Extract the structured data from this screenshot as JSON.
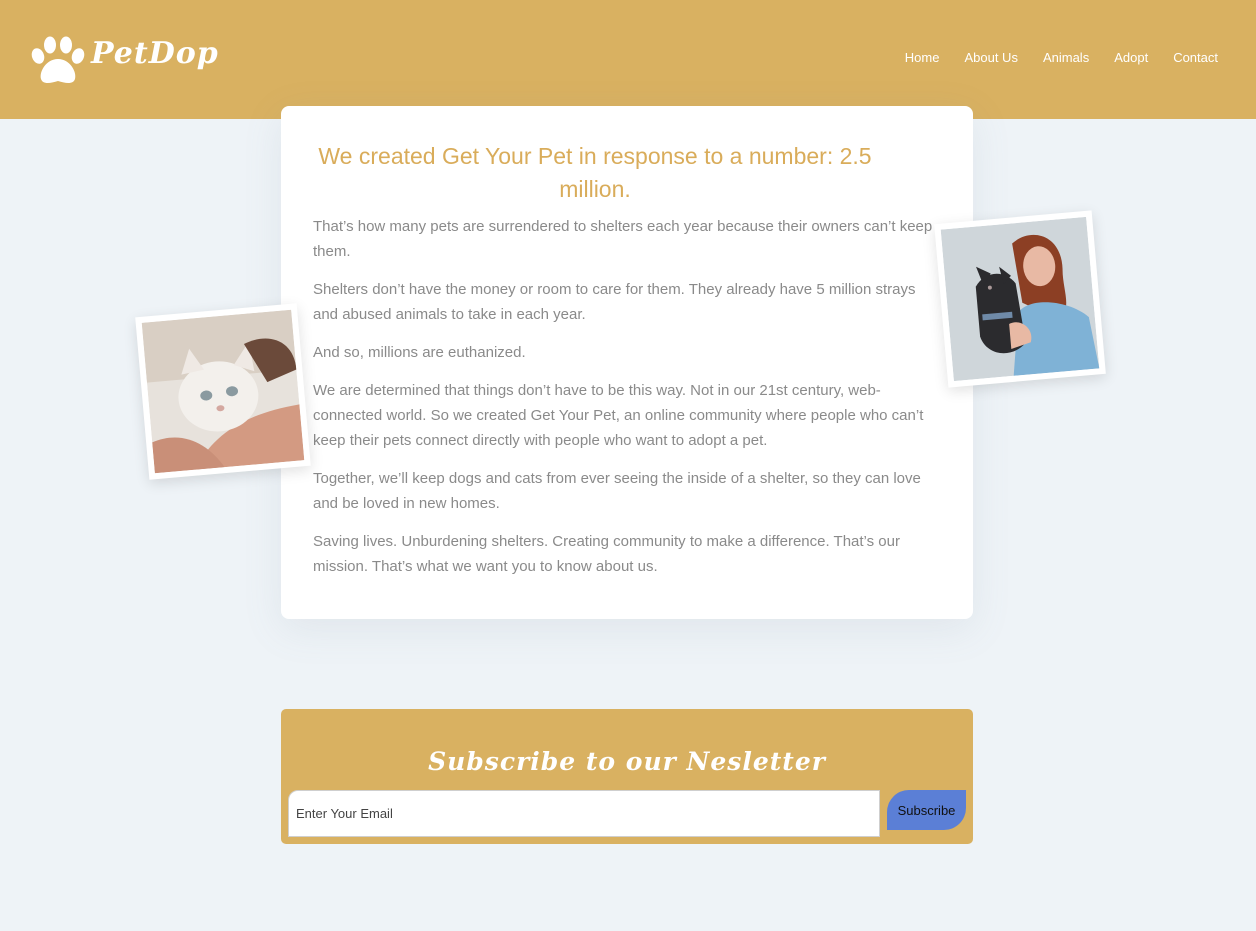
{
  "brand": {
    "name": "PetDop"
  },
  "nav": [
    {
      "label": "Home"
    },
    {
      "label": "About Us"
    },
    {
      "label": "Animals"
    },
    {
      "label": "Adopt"
    },
    {
      "label": "Contact"
    }
  ],
  "about": {
    "heading": "We created Get Your Pet in response to a number: 2.5 million.",
    "paragraphs": [
      "That’s how many pets are surrendered to shelters each year because their owners can’t keep them.",
      "Shelters don’t have the money or room to care for them. They already have 5 million strays and abused animals to take in each year.",
      "And so, millions are euthanized.",
      "We are determined that things don’t have to be this way. Not in our 21st century, web-connected world. So we created Get Your Pet, an online community where people who can’t keep their pets connect directly with people who want to adopt a pet.",
      "Together, we’ll keep dogs and cats from ever seeing the inside of a shelter, so they can love and be loved in new homes.",
      "Saving lives. Unburdening shelters. Creating community to make a difference. That’s our mission. That’s what we want you to know about us."
    ]
  },
  "newsletter": {
    "title": "Subscribe to our Nesletter",
    "email_placeholder": "Enter Your Email",
    "email_value": "",
    "button_label": "Subscribe"
  },
  "colors": {
    "header_bg": "#d9b161",
    "heading": "#d9ac5a",
    "body_text": "#8a8a8a",
    "button": "#5b7fd6",
    "page_bg": "#eef3f7"
  },
  "icons": {
    "logo": "paw-icon"
  }
}
